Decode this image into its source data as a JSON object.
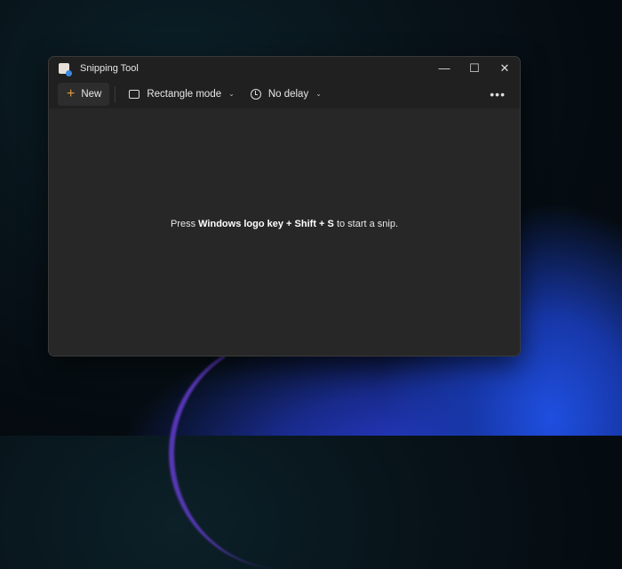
{
  "window": {
    "title": "Snipping Tool"
  },
  "title_controls": {
    "minimize": "—",
    "maximize": "☐",
    "close": "✕"
  },
  "toolbar": {
    "new_label": "New",
    "mode_label": "Rectangle mode",
    "delay_label": "No delay",
    "more": "•••"
  },
  "hint": {
    "p1": "Press ",
    "p2": "Windows logo key",
    "p3": " + ",
    "p4": "Shift",
    "p5": " + ",
    "p6": "S",
    "p7": " to start a snip."
  },
  "colors": {
    "accent": "#e39a3e",
    "window_bg": "#202020",
    "content_bg": "#272727"
  }
}
